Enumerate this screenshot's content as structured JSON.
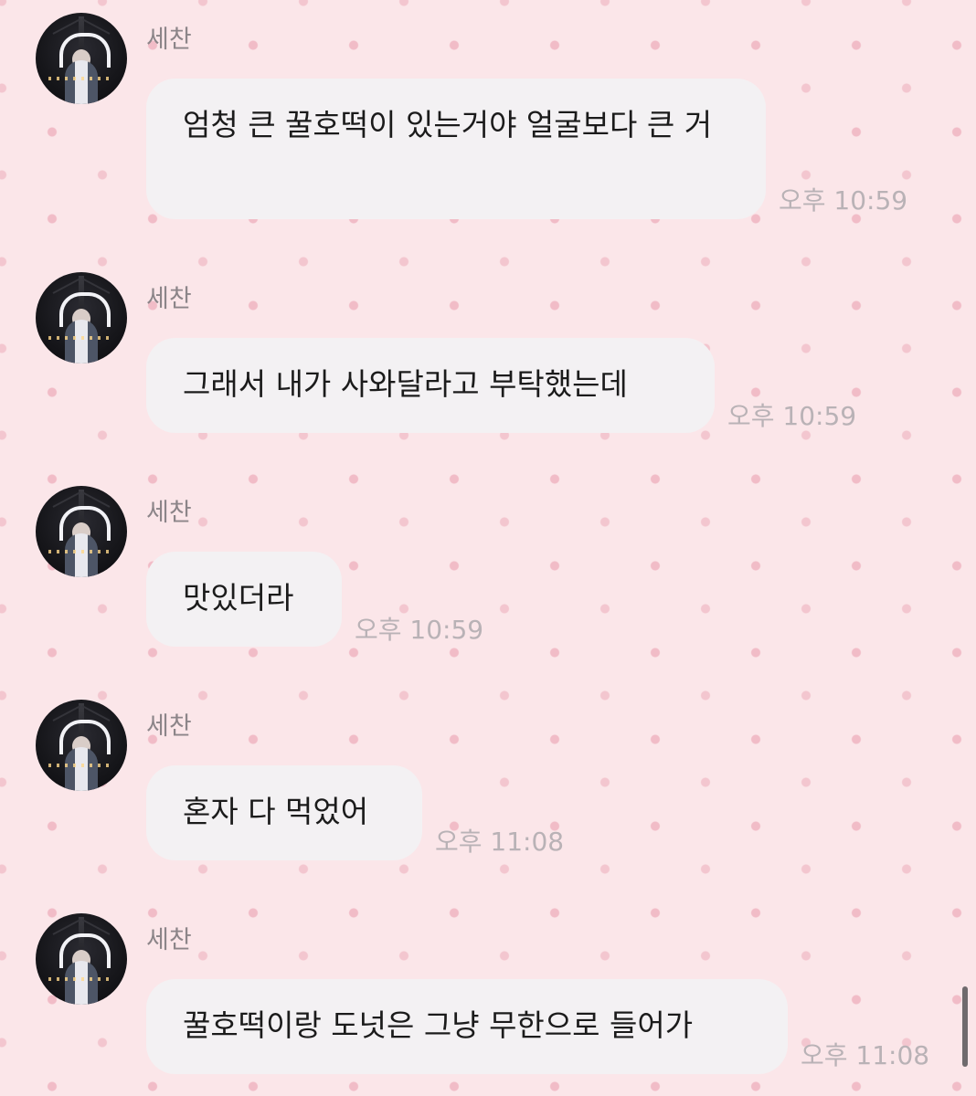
{
  "messages": [
    {
      "sender": "세찬",
      "text": "엄청 큰 꿀호떡이 있는거야 얼굴보다 큰 거",
      "time": "오후 10:59"
    },
    {
      "sender": "세찬",
      "text": "그래서 내가 사와달라고 부탁했는데",
      "time": "오후 10:59"
    },
    {
      "sender": "세찬",
      "text": "맛있더라",
      "time": "오후 10:59"
    },
    {
      "sender": "세찬",
      "text": "혼자 다 먹었어",
      "time": "오후 11:08"
    },
    {
      "sender": "세찬",
      "text": "꿀호떡이랑 도넛은 그냥 무한으로 들어가",
      "time": "오후 11:08"
    }
  ]
}
